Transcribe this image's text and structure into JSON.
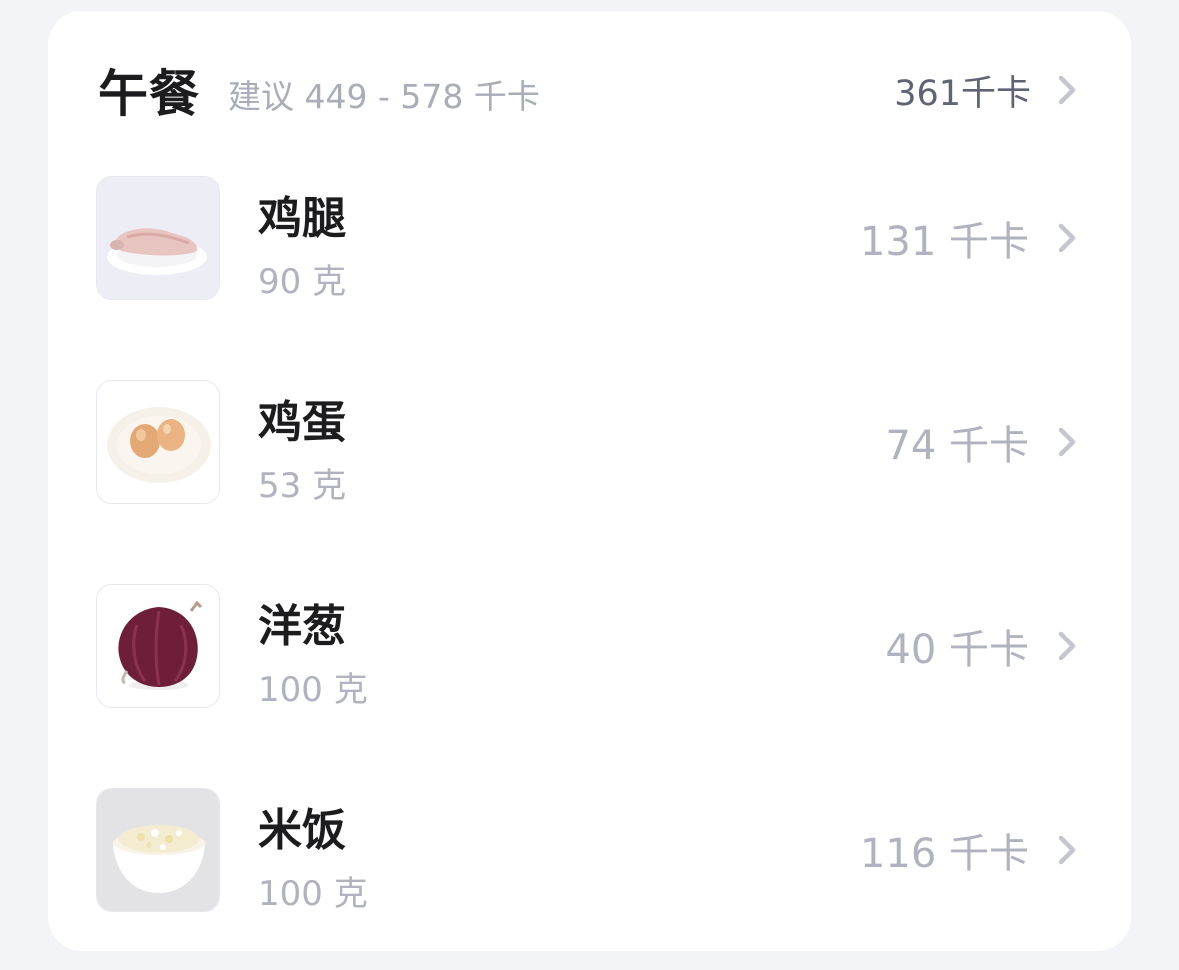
{
  "meal": {
    "title": "午餐",
    "suggestion": "建议 449 - 578 千卡",
    "total_kcal": "361千卡"
  },
  "items": [
    {
      "name": "鸡腿",
      "amount": "90 克",
      "kcal": "131 千卡",
      "icon": "chicken-leg"
    },
    {
      "name": "鸡蛋",
      "amount": "53 克",
      "kcal": "74 千卡",
      "icon": "eggs"
    },
    {
      "name": "洋葱",
      "amount": "100 克",
      "kcal": "40 千卡",
      "icon": "onion"
    },
    {
      "name": "米饭",
      "amount": "100 克",
      "kcal": "116 千卡",
      "icon": "rice-bowl"
    }
  ],
  "colors": {
    "background": "#f3f4f8",
    "card": "#ffffff",
    "title": "#1c1c1e",
    "muted": "#b0b3bf",
    "total": "#5f6475"
  }
}
